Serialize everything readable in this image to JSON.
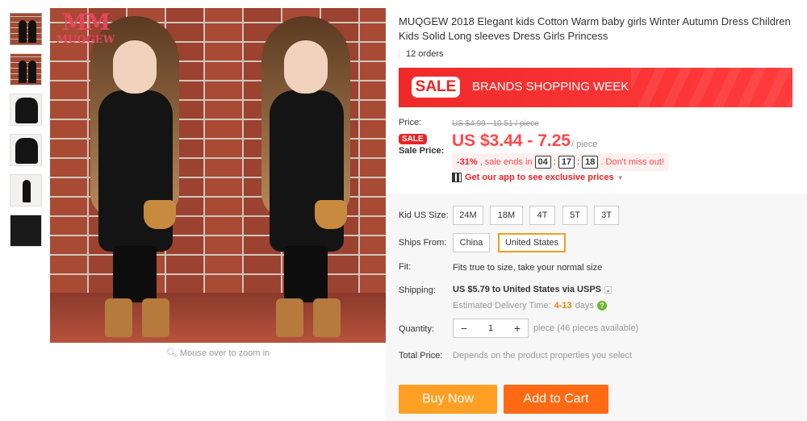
{
  "product": {
    "title": "MUQGEW 2018 Elegant kids Cotton Warm baby girls Winter Autumn Dress Children Kids Solid Long sleeves Dress Girls Princess",
    "orders": "12 orders"
  },
  "gallery": {
    "logo_mark": "MM",
    "logo_text": "MUQGEW",
    "zoom_hint": "Mouse over to zoom in",
    "thumbnail_count": 6
  },
  "sale_banner": {
    "tag": "SALE",
    "text": "BRANDS SHOPPING WEEK"
  },
  "price": {
    "label": "Price:",
    "original": "US $4.99 - 10.51 / piece",
    "sale_pill": "SALE",
    "sale_label": "Sale Price:",
    "sale_value": "US $3.44 - 7.25",
    "per": "/ piece"
  },
  "countdown": {
    "discount": "-31%",
    "text": ", sale ends in",
    "hours": "04",
    "minutes": "17",
    "seconds": "18",
    "suffix": ". Don't miss out!"
  },
  "app_promo": "Get our app to see exclusive prices",
  "options": {
    "size_label": "Kid US Size:",
    "sizes": [
      "24M",
      "18M",
      "4T",
      "5T",
      "3T"
    ],
    "ships_label": "Ships From:",
    "ships": [
      "China",
      "United States"
    ],
    "ships_selected": "United States",
    "fit_label": "Fit:",
    "fit_value": "Fits true to size, take your normal size"
  },
  "shipping": {
    "label": "Shipping:",
    "value": "US $5.79 to United States via USPS",
    "delivery_prefix": "Estimated Delivery Time:",
    "delivery_days": "4-13",
    "delivery_suffix": "days"
  },
  "quantity": {
    "label": "Quantity:",
    "value": "1",
    "note": "piece (46 pieces available)"
  },
  "total": {
    "label": "Total Price:",
    "value": "Depends on the product properties you select"
  },
  "actions": {
    "buy_now": "Buy Now",
    "add_to_cart": "Add to Cart"
  },
  "colors": {
    "sale_red": "#ff4747",
    "banner_red": "#f02a2a",
    "buy_orange": "#ffa024",
    "cart_orange": "#ff6a13",
    "selected_border": "#e8a21f"
  }
}
